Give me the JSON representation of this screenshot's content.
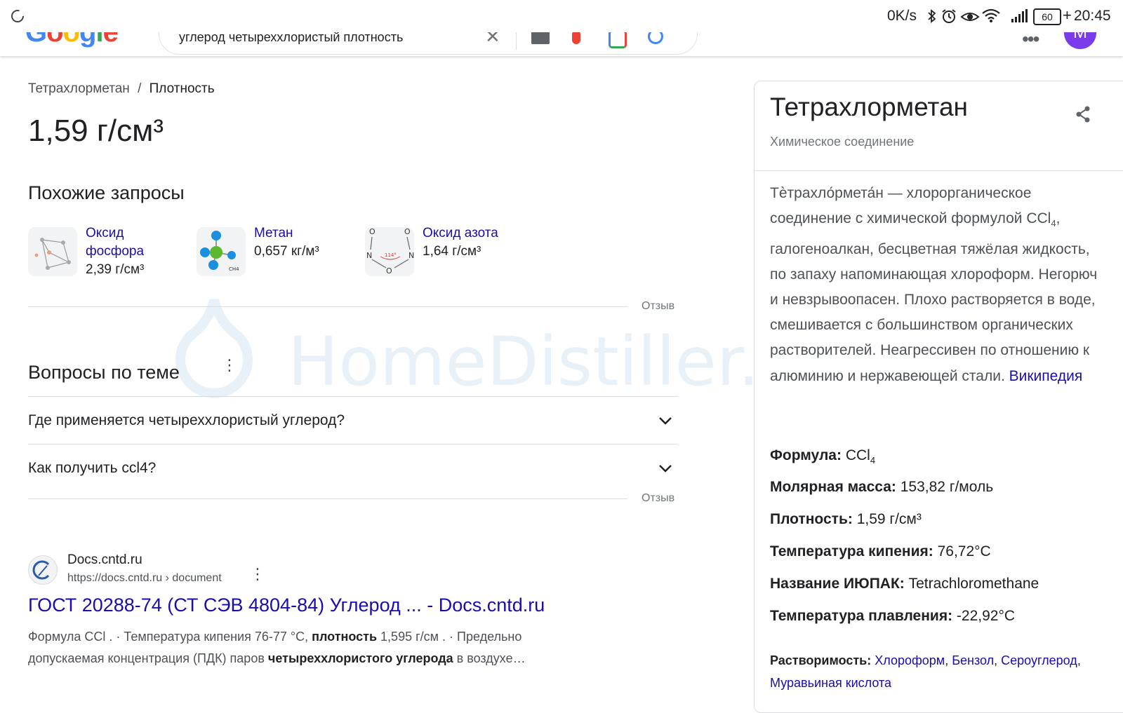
{
  "status_bar": {
    "net_speed": "0K/s",
    "battery": "60",
    "time": "20:45"
  },
  "header": {
    "logo": "Google",
    "query": "углерод четыреххлористый плотность",
    "avatar_letter": "M"
  },
  "watermark": "HomeDistiller.ru",
  "main": {
    "breadcrumb_root": "Тетрахлорметан",
    "breadcrumb_sep": "/",
    "breadcrumb_leaf": "Плотность",
    "answer": "1,59 г/см³",
    "related_heading": "Похожие запросы",
    "related": [
      {
        "title_line1": "Оксид",
        "title_line2": "фосфора",
        "value": "2,39 г/см³"
      },
      {
        "title_line1": "Метан",
        "title_line2": "",
        "value": "0,657 кг/м³"
      },
      {
        "title_line1": "Оксид азота",
        "title_line2": "",
        "value": "1,64 г/см³"
      }
    ],
    "feedback_label": "Отзыв",
    "questions_heading": "Вопросы по теме",
    "questions": [
      "Где применяется четыреххлористый углерод?",
      "Как получить ccl4?"
    ],
    "result": {
      "site": "Docs.cntd.ru",
      "url": "https://docs.cntd.ru › document",
      "title": "ГОСТ 20288-74 (СТ СЭВ 4804-84) Углерод ... - Docs.cntd.ru",
      "snippet_line1_a": "Формула CCl . · Температура кипения 76-77 °C, ",
      "snippet_line1_b": "плотность",
      "snippet_line1_c": " 1,595 г/см . · Предельно",
      "snippet_line2_a": "допускаемая концентрация (ПДК) паров ",
      "snippet_line2_b": "четыреххлористого углерода",
      "snippet_line2_c": " в воздухе…"
    }
  },
  "knowledge_panel": {
    "title": "Тетрахлорметан",
    "subtitle": "Химическое соединение",
    "description_a": "Тѐтрахло́рмета́н — хлорорганическое соединение с химической формулой CCl",
    "description_sub": "4",
    "description_b": ", галогеноалкан, бесцветная тяжёлая жидкость, по запаху напоминающая хлороформ. Негорюч и невзрывоопасен. Плохо растворяется в воде, смешивается с большинством органических растворителей. Неагрессивен по отношению к алюминию и нержавеющей стали. ",
    "description_link": "Википедия",
    "facts": {
      "formula_label": "Формула:",
      "formula_value": "CCl",
      "formula_sub": "4",
      "molar_label": "Молярная масса:",
      "molar_value": "153,82 г/моль",
      "density_label": "Плотность:",
      "density_value": "1,59 г/см³",
      "boiling_label": "Температура кипения:",
      "boiling_value": "76,72°C",
      "iupac_label": "Название ИЮПАК:",
      "iupac_value": "Tetrachloromethane",
      "melting_label": "Температура плавления:",
      "melting_value": "-22,92°C",
      "solubility_label": "Растворимость:",
      "solubility_links": [
        "Хлороформ",
        "Бензол",
        "Сероуглерод",
        "Муравьиная кислота"
      ]
    }
  },
  "colors": {
    "link": "#1a0dab",
    "text": "#202124",
    "secondary": "#4d5156",
    "muted": "#70757a",
    "avatar": "#7c3aed"
  }
}
